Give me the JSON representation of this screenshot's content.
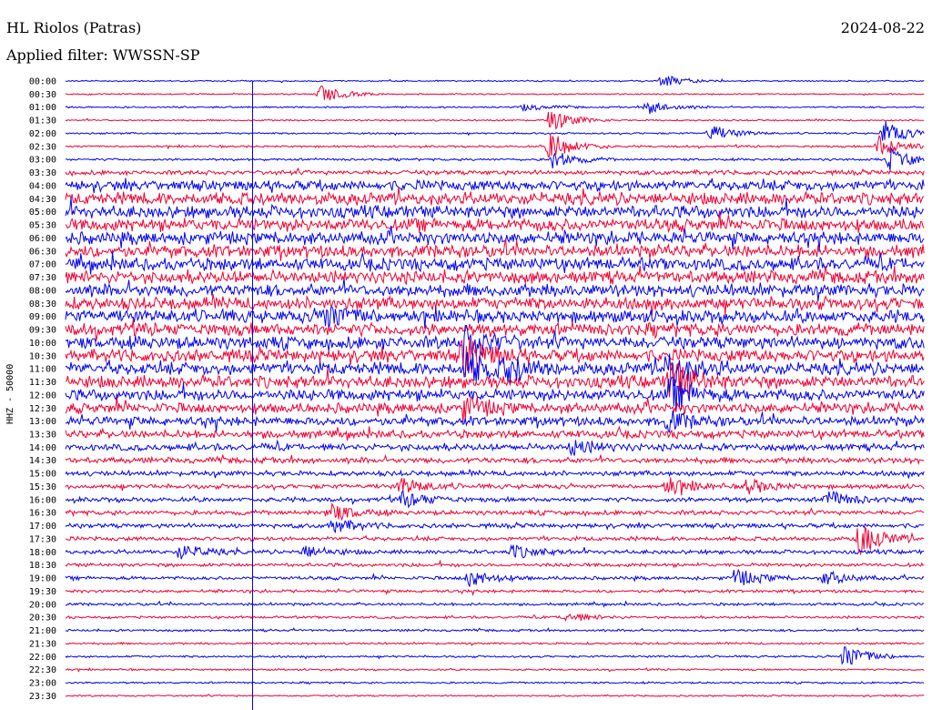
{
  "header": {
    "station": "HL Riolos (Patras)",
    "date": "2024-08-22",
    "filter": "Applied filter: WWSSN-SP"
  },
  "chart_data": {
    "type": "line",
    "title": "HL Riolos (Patras)",
    "subtitle": "Applied filter: WWSSN-SP",
    "ylabel": "HHZ - 50000",
    "trace_labels": [
      "00:00",
      "00:30",
      "01:00",
      "01:30",
      "02:00",
      "02:30",
      "03:00",
      "03:30",
      "04:00",
      "04:30",
      "05:00",
      "05:30",
      "06:00",
      "06:30",
      "07:00",
      "07:30",
      "08:00",
      "08:30",
      "09:00",
      "09:30",
      "10:00",
      "10:30",
      "11:00",
      "11:30",
      "12:00",
      "12:30",
      "13:00",
      "13:30",
      "14:00",
      "14:30",
      "15:00",
      "15:30",
      "16:00",
      "16:30",
      "17:00",
      "17:30",
      "18:00",
      "18:30",
      "19:00",
      "19:30",
      "20:00",
      "20:30",
      "21:00",
      "21:30",
      "22:00",
      "22:30",
      "23:00",
      "23:30"
    ],
    "trace_colors": [
      "#0000ee",
      "#ee0033"
    ],
    "minutes_per_trace": 30,
    "noise_level": [
      0.6,
      0.6,
      0.7,
      0.7,
      0.8,
      0.9,
      1.0,
      2.0,
      4.5,
      5.5,
      5.5,
      5.5,
      5.5,
      5.5,
      5.5,
      5.5,
      5.5,
      5.5,
      5.5,
      5.5,
      5.5,
      5.5,
      5.5,
      5.5,
      5.0,
      4.5,
      4.0,
      3.5,
      3.0,
      2.5,
      2.2,
      2.0,
      2.0,
      2.0,
      2.0,
      1.8,
      1.8,
      1.6,
      1.5,
      1.3,
      1.2,
      1.1,
      1.0,
      0.9,
      0.9,
      0.8,
      0.8,
      0.7
    ],
    "events": [
      {
        "trace": 0,
        "minute": 20.8,
        "amplitude": 7
      },
      {
        "trace": 1,
        "minute": 8.9,
        "amplitude": 10
      },
      {
        "trace": 2,
        "minute": 20.3,
        "amplitude": 8
      },
      {
        "trace": 2,
        "minute": 16.0,
        "amplitude": 4
      },
      {
        "trace": 3,
        "minute": 16.9,
        "amplitude": 12
      },
      {
        "trace": 4,
        "minute": 22.5,
        "amplitude": 9
      },
      {
        "trace": 4,
        "minute": 28.6,
        "amplitude": 14
      },
      {
        "trace": 5,
        "minute": 16.9,
        "amplitude": 16
      },
      {
        "trace": 5,
        "minute": 28.4,
        "amplitude": 12
      },
      {
        "trace": 6,
        "minute": 17.0,
        "amplitude": 10
      },
      {
        "trace": 6,
        "minute": 28.8,
        "amplitude": 12
      },
      {
        "trace": 18,
        "minute": 9.0,
        "amplitude": 14
      },
      {
        "trace": 20,
        "minute": 13.9,
        "amplitude": 20
      },
      {
        "trace": 21,
        "minute": 13.9,
        "amplitude": 22
      },
      {
        "trace": 22,
        "minute": 14.0,
        "amplitude": 16
      },
      {
        "trace": 22,
        "minute": 15.4,
        "amplitude": 12
      },
      {
        "trace": 22,
        "minute": 21.0,
        "amplitude": 20
      },
      {
        "trace": 23,
        "minute": 21.1,
        "amplitude": 22
      },
      {
        "trace": 24,
        "minute": 21.1,
        "amplitude": 16
      },
      {
        "trace": 25,
        "minute": 13.9,
        "amplitude": 12
      },
      {
        "trace": 26,
        "minute": 21.0,
        "amplitude": 10
      },
      {
        "trace": 28,
        "minute": 17.7,
        "amplitude": 8
      },
      {
        "trace": 31,
        "minute": 11.7,
        "amplitude": 9
      },
      {
        "trace": 31,
        "minute": 21.0,
        "amplitude": 10
      },
      {
        "trace": 31,
        "minute": 23.8,
        "amplitude": 8
      },
      {
        "trace": 32,
        "minute": 11.8,
        "amplitude": 9
      },
      {
        "trace": 32,
        "minute": 26.6,
        "amplitude": 10
      },
      {
        "trace": 33,
        "minute": 9.2,
        "amplitude": 10
      },
      {
        "trace": 34,
        "minute": 9.3,
        "amplitude": 8
      },
      {
        "trace": 35,
        "minute": 27.7,
        "amplitude": 18
      },
      {
        "trace": 36,
        "minute": 4.0,
        "amplitude": 8
      },
      {
        "trace": 36,
        "minute": 8.3,
        "amplitude": 7
      },
      {
        "trace": 36,
        "minute": 15.6,
        "amplitude": 7
      },
      {
        "trace": 38,
        "minute": 14.1,
        "amplitude": 9
      },
      {
        "trace": 38,
        "minute": 23.4,
        "amplitude": 10
      },
      {
        "trace": 38,
        "minute": 26.5,
        "amplitude": 8
      },
      {
        "trace": 41,
        "minute": 17.4,
        "amplitude": 6
      },
      {
        "trace": 44,
        "minute": 27.2,
        "amplitude": 14
      }
    ]
  }
}
